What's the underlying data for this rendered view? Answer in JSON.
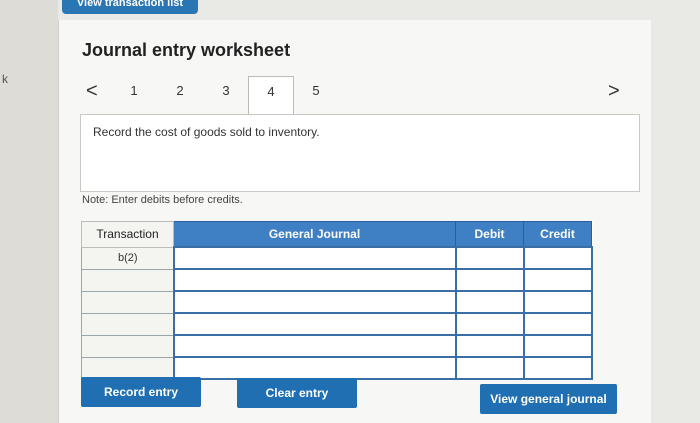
{
  "top_button": {
    "label": "View transaction list"
  },
  "left_edge": {
    "glyph": "k"
  },
  "worksheet": {
    "title": "Journal entry worksheet",
    "prev_symbol": "<",
    "next_symbol": ">",
    "tabs": [
      "1",
      "2",
      "3",
      "4",
      "5"
    ],
    "active_tab": "4",
    "instruction": "Record the cost of goods sold to inventory.",
    "note": "Note: Enter debits before credits."
  },
  "table": {
    "headers": {
      "transaction": "Transaction",
      "general_journal": "General Journal",
      "debit": "Debit",
      "credit": "Credit"
    },
    "rows": [
      {
        "transaction": "b(2)",
        "account": "",
        "debit": "",
        "credit": ""
      },
      {
        "transaction": "",
        "account": "",
        "debit": "",
        "credit": ""
      },
      {
        "transaction": "",
        "account": "",
        "debit": "",
        "credit": ""
      },
      {
        "transaction": "",
        "account": "",
        "debit": "",
        "credit": ""
      },
      {
        "transaction": "",
        "account": "",
        "debit": "",
        "credit": ""
      },
      {
        "transaction": "",
        "account": "",
        "debit": "",
        "credit": ""
      }
    ]
  },
  "buttons": {
    "record": "Record entry",
    "clear": "Clear entry",
    "view_journal": "View general journal"
  }
}
